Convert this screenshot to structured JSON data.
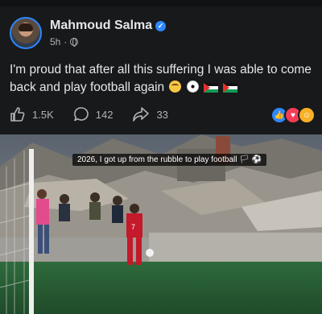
{
  "post": {
    "author_name": "Mahmoud Salma",
    "verified": true,
    "time": "5h",
    "audience_sep": "·",
    "text": "I'm proud that after all this suffering I was able to come back and play football again",
    "emojis": [
      "crying-face",
      "soccer-ball",
      "palestine-flag",
      "palestine-flag"
    ]
  },
  "actions": {
    "likes": "1.5K",
    "comments": "142",
    "shares": "33",
    "reactions": [
      "like",
      "love",
      "care"
    ]
  },
  "photo": {
    "caption": "2026, I got up from the rubble to play football 🏳 ⚽"
  },
  "colors": {
    "background": "#18191a",
    "text": "#e4e6eb",
    "muted": "#b0b3b8",
    "accent": "#2d88ff"
  }
}
